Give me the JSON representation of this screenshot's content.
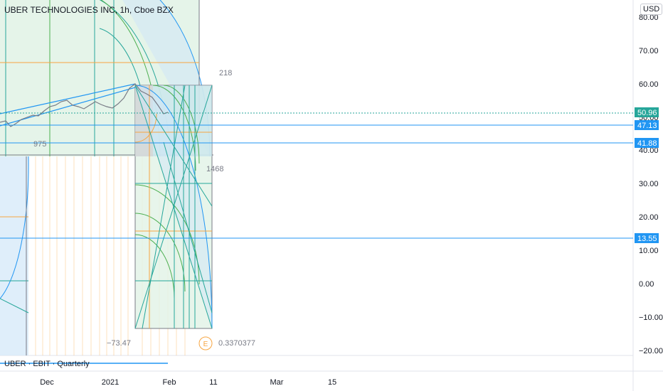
{
  "symbol": {
    "title": "UBER TECHNOLOGIES INC, 1h, Cboe BZX"
  },
  "currency": "USD",
  "indicator": {
    "label": "UBER · EBIT · Quarterly"
  },
  "price_axis": {
    "ticks": [
      "80.00",
      "70.00",
      "60.00",
      "50.00",
      "40.00",
      "30.00",
      "20.00",
      "10.00",
      "0.00",
      "−10.00",
      "−20.00"
    ]
  },
  "time_axis": {
    "ticks": [
      "Dec",
      "2021",
      "Feb",
      "11",
      "Mar",
      "15"
    ]
  },
  "price_tags": [
    {
      "value": "50.96",
      "color": "#26a69a"
    },
    {
      "value": "47.13",
      "color": "#2196f3"
    },
    {
      "value": "41.88",
      "color": "#2196f3"
    },
    {
      "value": "13.55",
      "color": "#2196f3"
    }
  ],
  "annotations": {
    "bars_label": "218",
    "bars_label_2": "975",
    "bars_label_3": "1468",
    "low_label": "−73.47",
    "ratio_label": "0.3370377",
    "earnings_marker": "E"
  },
  "colors": {
    "accent_blue": "#2196f3",
    "teal": "#26a69a",
    "orange": "#f7a541",
    "green_fill": "#c8e6c9",
    "blue_fill": "#bbdefb"
  }
}
